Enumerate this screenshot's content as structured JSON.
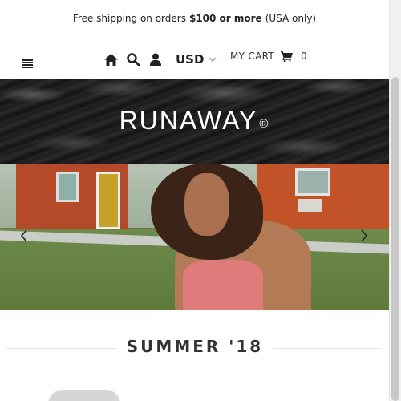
{
  "announcement": {
    "prefix": "Free shipping on orders",
    "highlight": "$100 or more",
    "suffix": "(USA only)"
  },
  "nav": {
    "menu_icon": "hamburger-icon",
    "icons": [
      "home-icon",
      "search-icon",
      "user-icon"
    ],
    "currency": "USD",
    "cart_label": "MY CART",
    "cart_icon": "cart-icon",
    "cart_count": "0"
  },
  "brand": {
    "logo_text": "RUNAWAY",
    "logo_mark": "®"
  },
  "hero": {
    "prev_icon": "chevron-left-icon",
    "next_icon": "chevron-right-icon"
  },
  "section": {
    "title": "SUMMER '18"
  },
  "colors": {
    "text": "#222222",
    "logo_band": "#111111",
    "divider": "#e6e6e6"
  }
}
